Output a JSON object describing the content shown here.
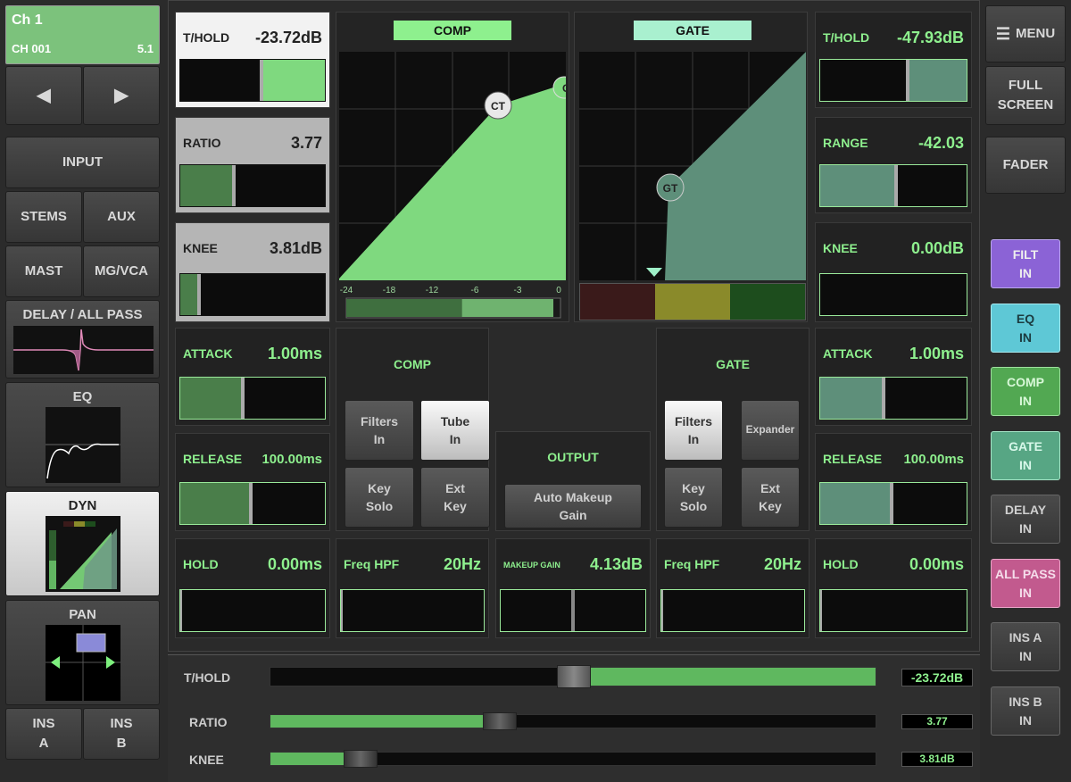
{
  "channel": {
    "name": "Ch 1",
    "id": "CH 001",
    "format": "5.1"
  },
  "nav": {
    "prev": "◀",
    "next": "▶"
  },
  "left_nav": {
    "input": "INPUT",
    "stems": "STEMS",
    "aux": "AUX",
    "mast": "MAST",
    "mgvca": "MG/VCA",
    "delay": "DELAY / ALL PASS",
    "eq": "EQ",
    "dyn": "DYN",
    "pan": "PAN",
    "ins_a_1": "INS",
    "ins_a_2": "A",
    "ins_b_1": "INS",
    "ins_b_2": "B"
  },
  "comp": {
    "header": "COMP",
    "threshold": {
      "label": "T/HOLD",
      "value": "-23.72dB",
      "level": 0.56
    },
    "ratio": {
      "label": "RATIO",
      "value": "3.77",
      "level": 0.37
    },
    "knee": {
      "label": "KNEE",
      "value": "3.81dB",
      "level": 0.13
    },
    "attack": {
      "label": "ATTACK",
      "value": "1.00ms",
      "level": 0.43
    },
    "release": {
      "label": "RELEASE",
      "value": "100.00ms",
      "level": 0.49
    },
    "hold": {
      "label": "HOLD",
      "value": "0.00ms",
      "level": 0.0
    },
    "panel_title": "COMP",
    "filters_1": "Filters",
    "filters_2": "In",
    "tube_1": "Tube",
    "tube_2": "In",
    "key_solo_1": "Key",
    "key_solo_2": "Solo",
    "ext_key_1": "Ext",
    "ext_key_2": "Key",
    "freq_hpf": {
      "label": "Freq HPF",
      "value": "20Hz",
      "level": 0.0
    },
    "graph_marker": "CT",
    "graph_marker2": "C",
    "meter_ticks": [
      "-24",
      "-18",
      "-12",
      "-6",
      "-3",
      "0"
    ],
    "meter_level": 0.54
  },
  "gate": {
    "header": "GATE",
    "threshold": {
      "label": "T/HOLD",
      "value": "-47.93dB",
      "level": 0.6
    },
    "range": {
      "label": "RANGE",
      "value": "-42.03",
      "level": 0.52
    },
    "knee": {
      "label": "KNEE",
      "value": "0.00dB",
      "level": 0.0
    },
    "attack": {
      "label": "ATTACK",
      "value": "1.00ms",
      "level": 0.43
    },
    "release": {
      "label": "RELEASE",
      "value": "100.00ms",
      "level": 0.49
    },
    "hold": {
      "label": "HOLD",
      "value": "0.00ms",
      "level": 0.0
    },
    "panel_title": "GATE",
    "filters_1": "Filters",
    "filters_2": "In",
    "expander": "Expander",
    "key_solo_1": "Key",
    "key_solo_2": "Solo",
    "ext_key_1": "Ext",
    "ext_key_2": "Key",
    "freq_hpf": {
      "label": "Freq HPF",
      "value": "20Hz",
      "level": 0.0
    },
    "graph_marker": "GT"
  },
  "output": {
    "title": "OUTPUT",
    "auto_makeup_1": "Auto Makeup",
    "auto_makeup_2": "Gain",
    "makeup": {
      "label": "MAKEUP GAIN",
      "value": "4.13dB",
      "level": 0.5
    }
  },
  "right_nav": {
    "menu": "MENU",
    "full_1": "FULL",
    "full_2": "SCREEN",
    "fader": "FADER",
    "filt_1": "FILT",
    "filt_2": "IN",
    "eq_1": "EQ",
    "eq_2": "IN",
    "comp_1": "COMP",
    "comp_2": "IN",
    "gate_1": "GATE",
    "gate_2": "IN",
    "delay_1": "DELAY",
    "delay_2": "IN",
    "allpass_1": "ALL PASS",
    "allpass_2": "IN",
    "insa_1": "INS A",
    "insa_2": "IN",
    "insb_1": "INS B",
    "insb_2": "IN"
  },
  "faders": [
    {
      "label": "T/HOLD",
      "value": "-23.72dB",
      "level": 0.5
    },
    {
      "label": "RATIO",
      "value": "3.77",
      "level": 0.38
    },
    {
      "label": "KNEE",
      "value": "3.81dB",
      "level": 0.15
    }
  ],
  "colors": {
    "green": "#8ef08e",
    "fill": "#7fd97f",
    "gate_fill": "#5e8f7a"
  }
}
